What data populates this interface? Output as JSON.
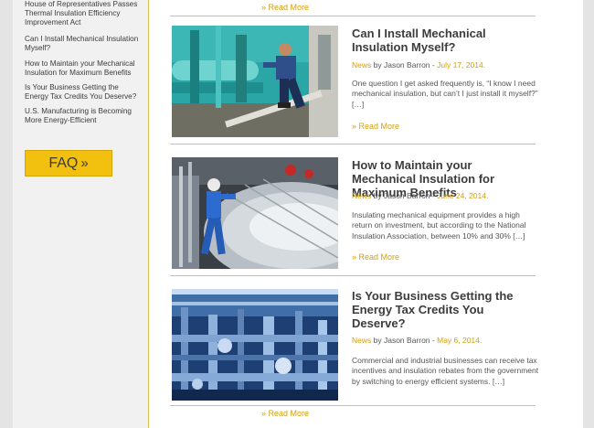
{
  "sidebar": {
    "links": [
      "House of Representatives Passes Thermal Insulation Efficiency Improvement Act",
      "Can I Install Mechanical Insulation Myself?",
      "How to Maintain your Mechanical Insulation for Maximum Benefits",
      "Is Your Business Getting the Energy Tax Credits You Deserve?",
      "U.S. Manufacturing is Becoming More Energy-Efficient"
    ],
    "faq_label": "FAQ",
    "faq_chevron": "»"
  },
  "read_more": "» Read More",
  "posts": [
    {
      "title": "Can I Install Mechanical Insulation Myself?",
      "category": "News",
      "by": "by Jason Barron -",
      "date": "July 17, 2014.",
      "excerpt": "One question I get asked frequently is, “I know I need mechanical insulation, but can’t I just install it myself?” […]",
      "read_more": "» Read More"
    },
    {
      "title": "How to Maintain your Mechanical Insulation for Maximum Benefits",
      "category": "News",
      "by": "by Jason Barron -",
      "date": "June 24, 2014.",
      "excerpt": "Insulating mechanical equipment provides a high return on investment, but according to the National Insulation Association, between 10% and 30% […]",
      "read_more": "» Read More"
    },
    {
      "title": "Is Your Business Getting the Energy Tax Credits You Deserve?",
      "category": "News",
      "by": "by Jason Barron -",
      "date": "May 6, 2014.",
      "excerpt": "Commercial and industrial businesses can receive tax incentives and insulation rebates from the government by switching to energy efficient systems. […]",
      "read_more": "» Read More"
    }
  ],
  "colors": {
    "accent": "#d4a00e",
    "faq_bg": "#f2c10f",
    "divider": "#e2c63f"
  }
}
